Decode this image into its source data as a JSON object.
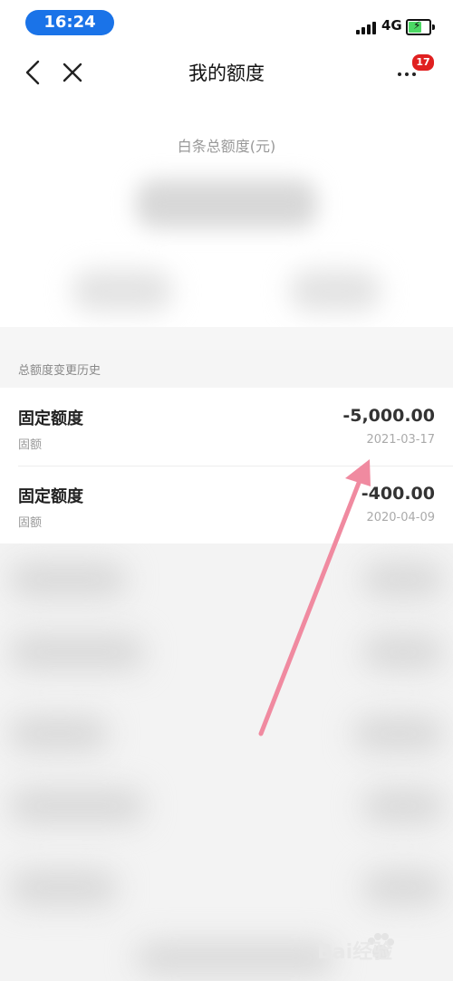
{
  "status_bar": {
    "time": "16:24",
    "network": "4G",
    "battery_level": 0.6
  },
  "nav": {
    "title": "我的额度",
    "back_icon": "chevron-left-icon",
    "close_icon": "close-icon",
    "more_icon": "more-dots-icon",
    "badge_count": "17"
  },
  "total": {
    "label": "白条总额度(元)"
  },
  "history": {
    "header": "总额度变更历史",
    "items": [
      {
        "title": "固定额度",
        "subtitle": "固额",
        "amount": "-5,000.00",
        "date": "2021-03-17"
      },
      {
        "title": "固定额度",
        "subtitle": "固额",
        "amount": "-400.00",
        "date": "2020-04-09"
      }
    ]
  },
  "watermark": {
    "logo": "baidu-paw-logo",
    "text": "Bai经验"
  },
  "colors": {
    "time_pill": "#1a73e8",
    "badge": "#e02020",
    "arrow": "#f08aa0"
  }
}
